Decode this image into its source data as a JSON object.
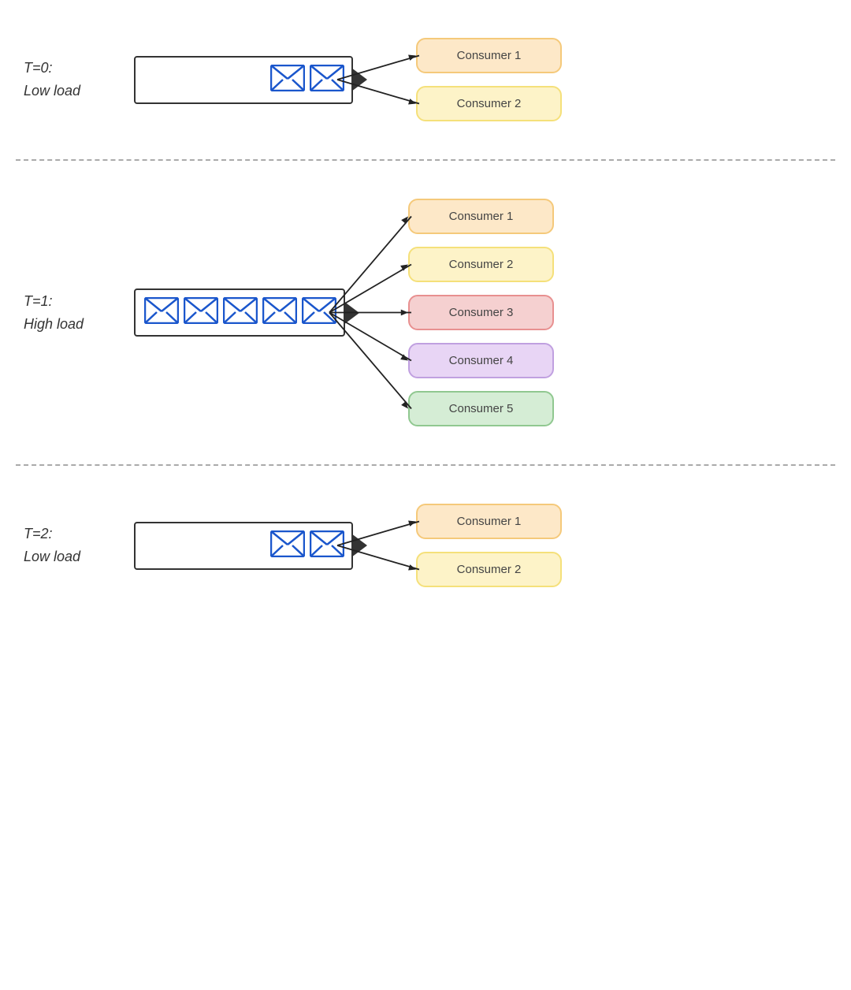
{
  "sections": [
    {
      "id": "t0",
      "label_line1": "T=0:",
      "label_line2": "Low load",
      "messages": 2,
      "consumers": [
        {
          "label": "Consumer 1",
          "color_bg": "#fde8c8",
          "color_border": "#f5c97a"
        },
        {
          "label": "Consumer 2",
          "color_bg": "#fdf3c8",
          "color_border": "#f5e07a"
        }
      ]
    },
    {
      "id": "t1",
      "label_line1": "T=1:",
      "label_line2": "High load",
      "messages": 5,
      "consumers": [
        {
          "label": "Consumer 1",
          "color_bg": "#fde8c8",
          "color_border": "#f5c97a"
        },
        {
          "label": "Consumer 2",
          "color_bg": "#fdf3c8",
          "color_border": "#f5e07a"
        },
        {
          "label": "Consumer 3",
          "color_bg": "#f5d0d0",
          "color_border": "#e89090"
        },
        {
          "label": "Consumer 4",
          "color_bg": "#e8d5f5",
          "color_border": "#c0a0e0"
        },
        {
          "label": "Consumer 5",
          "color_bg": "#d5edd5",
          "color_border": "#90c890"
        }
      ]
    },
    {
      "id": "t2",
      "label_line1": "T=2:",
      "label_line2": "Low load",
      "messages": 2,
      "consumers": [
        {
          "label": "Consumer 1",
          "color_bg": "#fde8c8",
          "color_border": "#f5c97a"
        },
        {
          "label": "Consumer 2",
          "color_bg": "#fdf3c8",
          "color_border": "#f5e07a"
        }
      ]
    }
  ]
}
